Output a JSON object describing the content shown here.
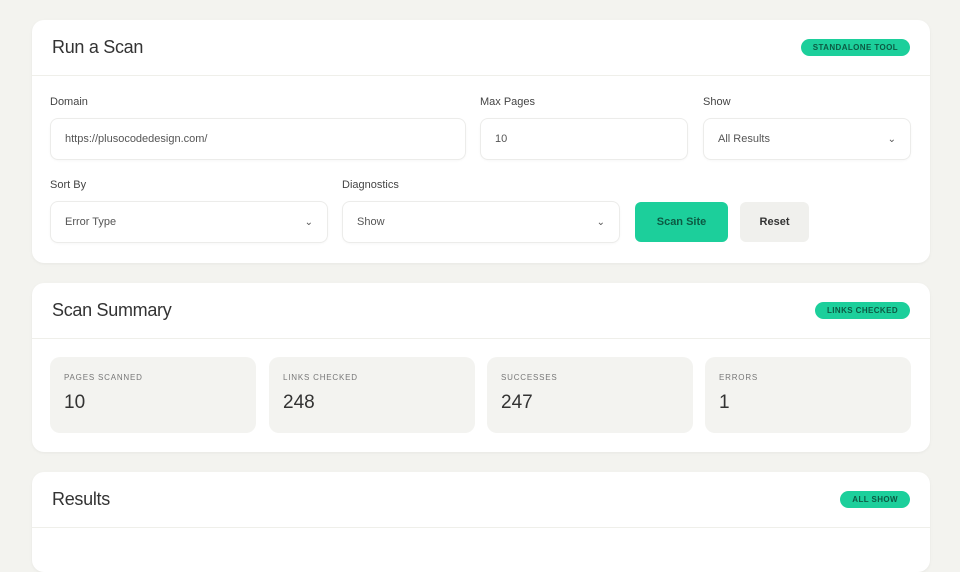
{
  "scan": {
    "title": "Run a Scan",
    "badge": "STANDALONE TOOL",
    "domain_label": "Domain",
    "domain_value": "https://plusocodedesign.com/",
    "max_pages_label": "Max Pages",
    "max_pages_value": "10",
    "show_label": "Show",
    "show_value": "All Results",
    "sort_label": "Sort By",
    "sort_value": "Error Type",
    "diagnostics_label": "Diagnostics",
    "diagnostics_value": "Show",
    "scan_button": "Scan Site",
    "reset_button": "Reset"
  },
  "summary": {
    "title": "Scan Summary",
    "badge": "LINKS CHECKED",
    "stats": [
      {
        "label": "PAGES SCANNED",
        "value": "10"
      },
      {
        "label": "LINKS CHECKED",
        "value": "248"
      },
      {
        "label": "SUCCESSES",
        "value": "247"
      },
      {
        "label": "ERRORS",
        "value": "1"
      }
    ]
  },
  "results": {
    "title": "Results",
    "badge": "ALL SHOW"
  },
  "colors": {
    "accent": "#1ccf9b",
    "background": "#f3f3ef",
    "card": "#ffffff"
  }
}
